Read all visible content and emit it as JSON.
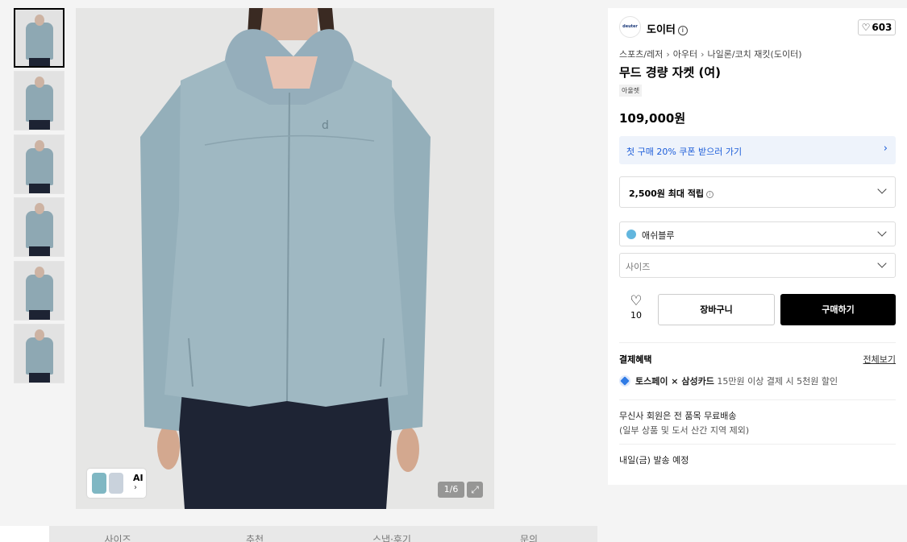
{
  "gallery": {
    "thumbnail_count": 6,
    "counter_text": "1/6",
    "ai_label": "AI",
    "ai_chevron": "›",
    "expand_icon": "expand-icon"
  },
  "product": {
    "brand": "도이터",
    "brand_logo_text": "deuter",
    "like_count": "603",
    "breadcrumb": [
      "스포츠/레저",
      "아우터",
      "나일론/코치 재킷(도이터)"
    ],
    "title": "무드 경량 자켓 (여)",
    "tag": "아울렛",
    "price": "109,000원",
    "coupon_text": "첫 구매 20% 쿠폰 받으러 가기",
    "points_text": "2,500원 최대 적립",
    "color_option": "애쉬블루",
    "color_swatch": "#62b6de",
    "size_placeholder": "사이즈",
    "wish_count": "10",
    "cart_label": "장바구니",
    "buy_label": "구매하기",
    "benefits_title": "결제혜택",
    "benefits_view_all": "전체보기",
    "pay_brand": "토스페이 × 삼성카드",
    "pay_desc": "15만원 이상 결제 시 5천원 할인",
    "shipping_line1": "무신사 회원은 전 품목 무료배송",
    "shipping_line2": "(일부 상품 및 도서 산간 지역 제외)",
    "dispatch": "내일(금) 발송 예정"
  },
  "tabs": [
    "사이즈",
    "추천",
    "스냅·후기",
    "문의"
  ],
  "colors": {
    "accent_blue": "#1c5dd9",
    "buy_button": "#000000",
    "coupon_bg": "#eef3fb"
  }
}
